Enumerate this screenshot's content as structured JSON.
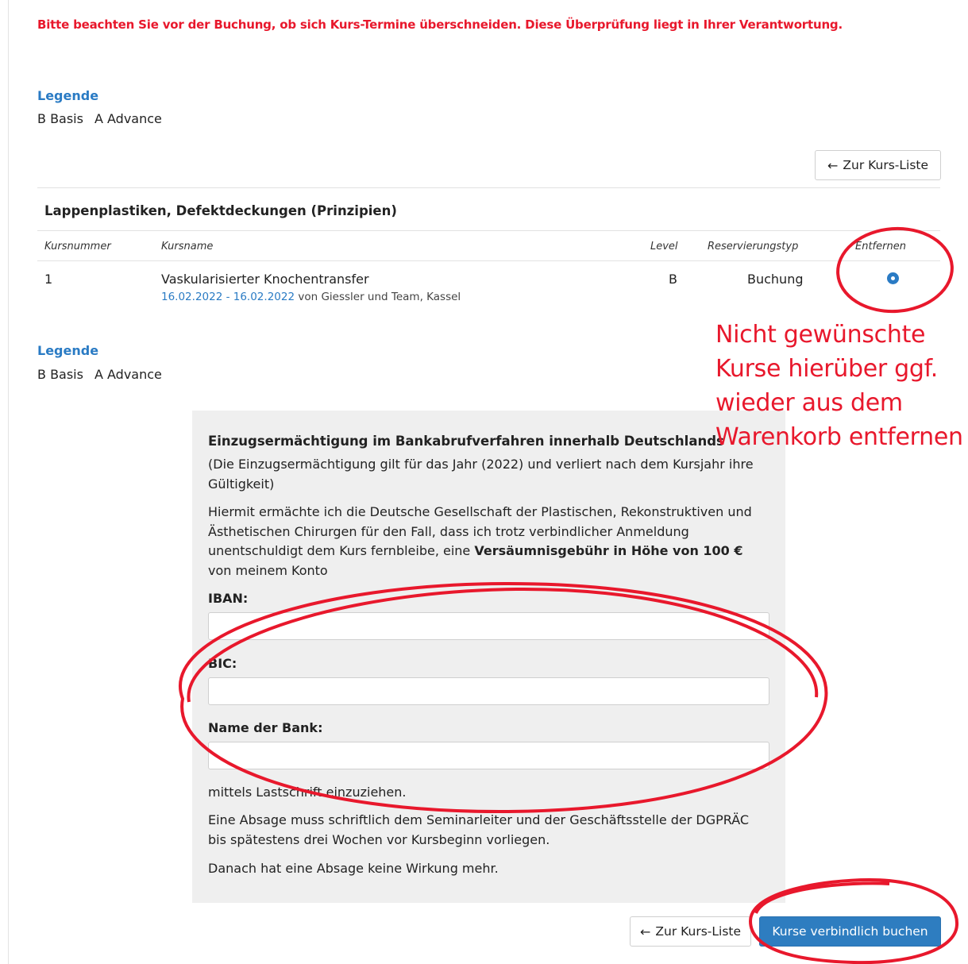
{
  "warning": "Bitte beachten Sie vor der Buchung, ob sich Kurs-Termine überschneiden. Diese Überprüfung liegt in Ihrer Verantwortung.",
  "legend": {
    "title": "Legende",
    "items": [
      "B Basis",
      "A Advance"
    ]
  },
  "buttons": {
    "back_to_list": "Zur Kurs-Liste",
    "book": "Kurse verbindlich buchen"
  },
  "course_group": {
    "title": "Lappenplastiken, Defektdeckungen (Prinzipien)",
    "columns": [
      "Kursnummer",
      "Kursname",
      "Level",
      "Reservierungstyp",
      "Entfernen"
    ],
    "rows": [
      {
        "number": "1",
        "name": "Vaskularisierter Knochentransfer",
        "dates": "16.02.2022 - 16.02.2022",
        "by": "von Giessler und Team, Kassel",
        "level": "B",
        "reservation_type": "Buchung"
      }
    ]
  },
  "annotation": {
    "lines": [
      "Nicht gewünschte",
      "Kurse hierüber ggf.",
      "wieder aus dem",
      "Warenkorb entfernen"
    ],
    "color": "#e8182c"
  },
  "mandate": {
    "heading": "Einzugsermächtigung im Bankabrufverfahren innerhalb Deutschlands",
    "validity": "(Die Einzugsermächtigung gilt für das Jahr (2022) und verliert nach dem Kursjahr ihre Gültigkeit)",
    "authorization_pre": "Hiermit ermächte ich die Deutsche Gesellschaft der Plastischen, Rekonstruktiven und Ästhetischen Chirurgen für den Fall, dass ich trotz verbindlicher Anmeldung unentschuldigt dem Kurs fernbleibe, eine ",
    "authorization_bold": "Versäumnisgebühr in Höhe von 100 €",
    "authorization_post": " von meinem Konto",
    "iban_label": "IBAN:",
    "bic_label": "BIC:",
    "bank_label": "Name der Bank:",
    "iban_value": "",
    "bic_value": "",
    "bank_value": "",
    "debit_text": "mittels Lastschrift einzuziehen.",
    "cancellation_text": "Eine Absage muss schriftlich dem Seminarleiter und der Geschäftsstelle der DGPRÄC bis spätestens drei Wochen vor Kursbeginn vorliegen.",
    "after_text": "Danach hat eine Absage keine Wirkung mehr."
  },
  "colors": {
    "accent": "#2a7bc4",
    "warning": "#e8182c",
    "primary_button": "#2e7dc0"
  }
}
